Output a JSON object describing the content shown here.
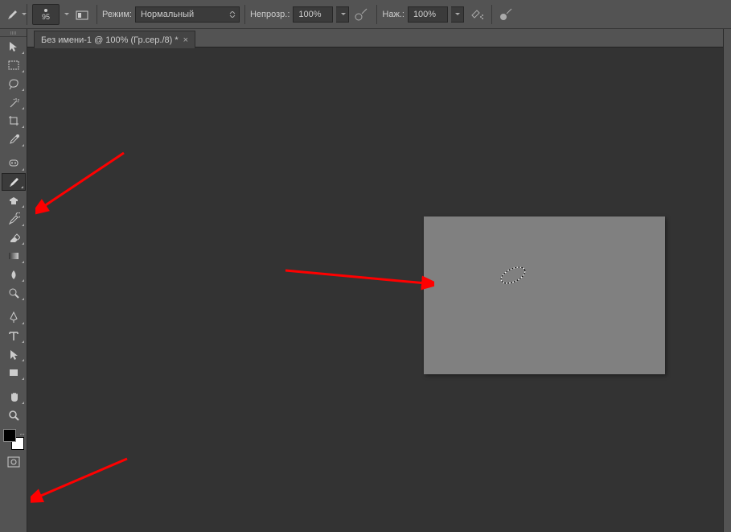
{
  "options": {
    "brush_size": "95",
    "mode_label": "Режим:",
    "mode_value": "Нормальный",
    "opacity_label": "Непрозр.:",
    "opacity_value": "100%",
    "flow_label": "Наж.:",
    "flow_value": "100%"
  },
  "tab": {
    "title": "Без имени-1 @ 100% (Гр.сер./8) *",
    "close": "×"
  },
  "tools": [
    {
      "name": "move-tool",
      "corner": true
    },
    {
      "name": "marquee-tool",
      "corner": true
    },
    {
      "name": "lasso-tool",
      "corner": true
    },
    {
      "name": "magic-wand-tool",
      "corner": true
    },
    {
      "name": "crop-tool",
      "corner": true
    },
    {
      "name": "eyedropper-tool",
      "corner": true
    },
    {
      "name": "healing-brush-tool",
      "corner": true,
      "spaced": true
    },
    {
      "name": "brush-tool",
      "corner": true,
      "active": true
    },
    {
      "name": "clone-stamp-tool",
      "corner": true
    },
    {
      "name": "history-brush-tool",
      "corner": true
    },
    {
      "name": "eraser-tool",
      "corner": true
    },
    {
      "name": "gradient-tool",
      "corner": true
    },
    {
      "name": "blur-tool",
      "corner": true
    },
    {
      "name": "dodge-tool",
      "corner": true
    },
    {
      "name": "pen-tool",
      "corner": true,
      "spaced": true
    },
    {
      "name": "type-tool",
      "corner": true
    },
    {
      "name": "path-selection-tool",
      "corner": true
    },
    {
      "name": "shape-tool",
      "corner": true
    },
    {
      "name": "hand-tool",
      "corner": true,
      "spaced": true
    },
    {
      "name": "zoom-tool",
      "corner": false
    }
  ],
  "swatch": {
    "fg": "#000000",
    "bg": "#ffffff"
  },
  "colors": {
    "accent": "#ff0000"
  }
}
